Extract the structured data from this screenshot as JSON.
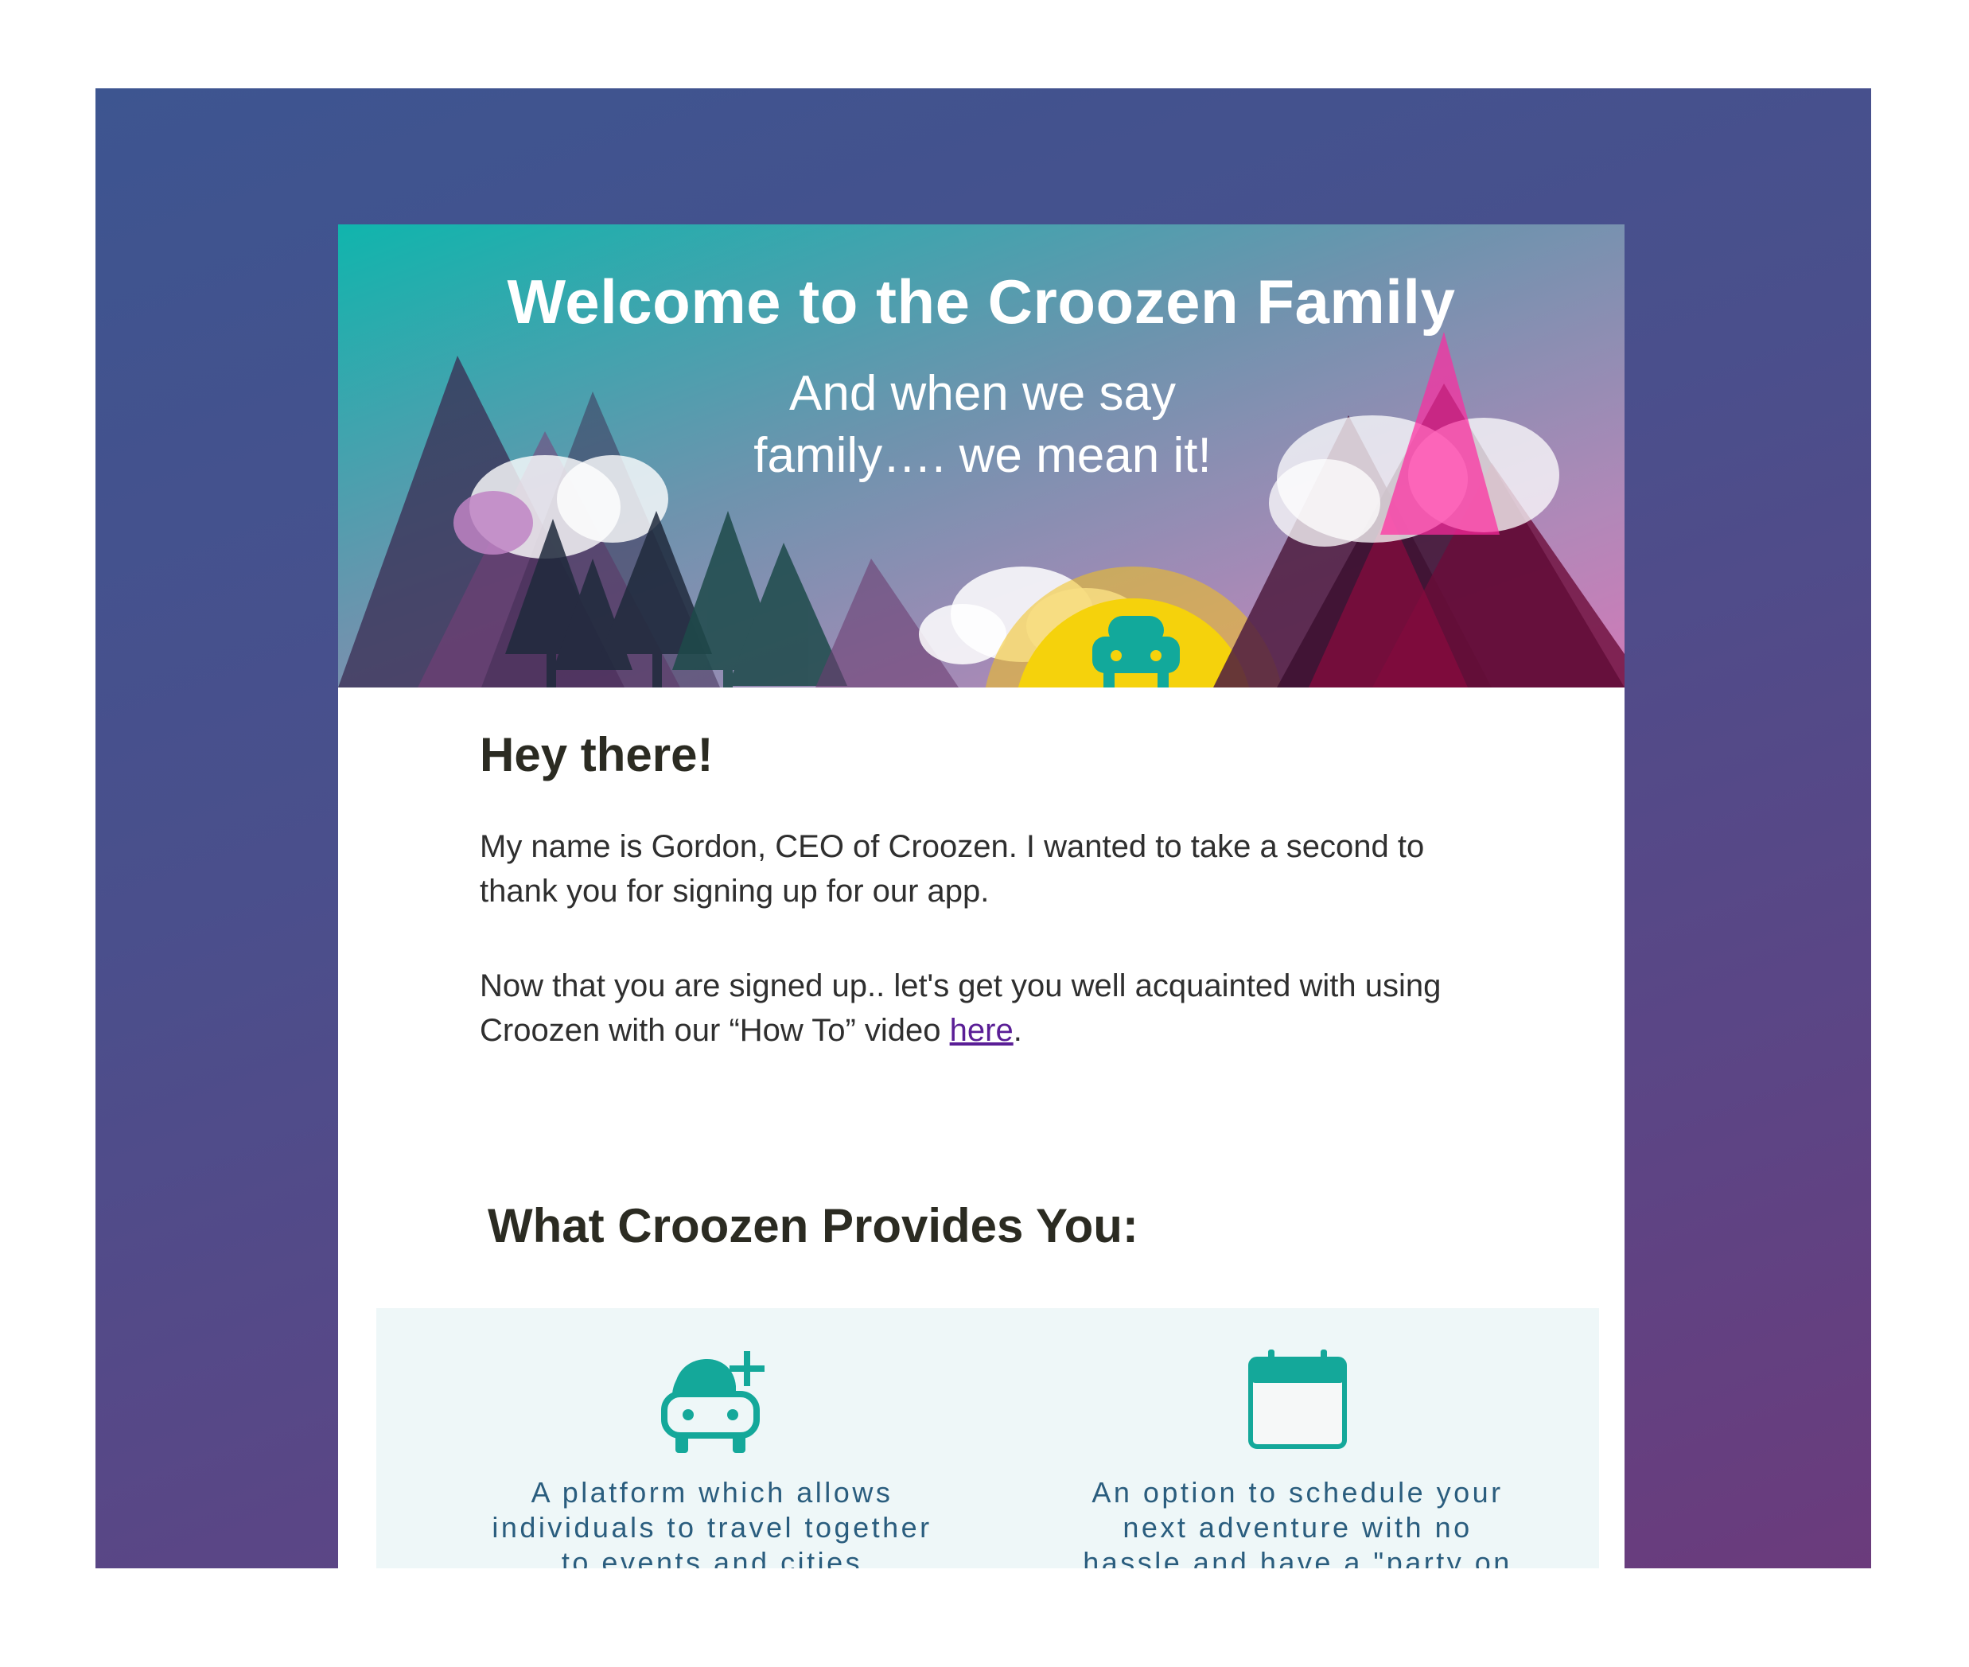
{
  "header": {
    "title": "Welcome to the Croozen Family",
    "subtitle": "And when we say family…. we mean it!"
  },
  "body": {
    "greeting": "Hey there!",
    "paragraph1": "My name is Gordon, CEO of Croozen. I wanted to take a second to thank you for signing up for our app.",
    "paragraph2_before": "Now that you are signed up.. let's get you well acquainted with using Croozen with our “How To” video ",
    "paragraph2_link": "here",
    "paragraph2_after": ".",
    "provides_heading": "What Croozen Provides You:"
  },
  "features": [
    {
      "icon": "car-plus-icon",
      "text": "A platform which allows individuals to travel together to events and cities throughout the USA"
    },
    {
      "icon": "calendar-icon",
      "text": "An option to schedule your next adventure with no hassle and have a \"party on wheels\""
    }
  ],
  "colors": {
    "background_start": "#3d5590",
    "background_end": "#6b3b7c",
    "hero_teal": "#12b3ad",
    "hero_pink": "#c07ab8",
    "accent_teal": "#14a89a",
    "feature_text": "#2a5d7e",
    "link": "#5a1e96",
    "heading": "#2b2b22"
  }
}
